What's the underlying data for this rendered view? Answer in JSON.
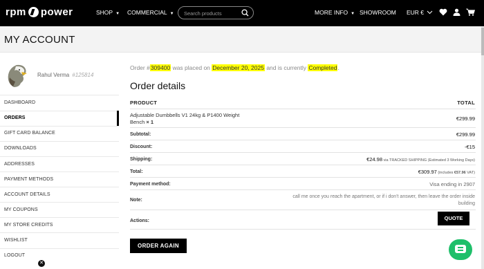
{
  "header": {
    "brand": {
      "left": "rpm",
      "right": "power"
    },
    "nav_left": [
      {
        "label": "SHOP",
        "dropdown": true
      },
      {
        "label": "COMMERCIAL",
        "dropdown": true
      }
    ],
    "search": {
      "placeholder": "Search products",
      "value": ""
    },
    "nav_right": [
      {
        "label": "MORE INFO",
        "dropdown": true
      },
      {
        "label": "SHOWROOM",
        "dropdown": false
      }
    ],
    "currency": "EUR €",
    "icons": [
      "heart-icon",
      "user-icon",
      "cart-icon"
    ]
  },
  "page_title": "MY ACCOUNT",
  "user": {
    "name": "Rahul Verma",
    "id": "#125814"
  },
  "sidebar": {
    "items": [
      {
        "label": "DASHBOARD",
        "active": false
      },
      {
        "label": "ORDERS",
        "active": true
      },
      {
        "label": "GIFT CARD BALANCE",
        "active": false
      },
      {
        "label": "DOWNLOADS",
        "active": false
      },
      {
        "label": "ADDRESSES",
        "active": false
      },
      {
        "label": "PAYMENT METHODS",
        "active": false
      },
      {
        "label": "ACCOUNT DETAILS",
        "active": false
      },
      {
        "label": "MY COUPONS",
        "active": false
      },
      {
        "label": "MY STORE CREDITS",
        "active": false
      },
      {
        "label": "WISHLIST",
        "active": false
      },
      {
        "label": "LOGOUT",
        "active": false
      }
    ]
  },
  "order": {
    "notice": {
      "prefix": "Order #",
      "number": "309400",
      "mid1": " was placed on ",
      "date": "December 20, 2025",
      "mid2": " and is currently ",
      "status": "Completed",
      "suffix": "."
    },
    "title": "Order details",
    "columns": {
      "product": "PRODUCT",
      "total": "TOTAL"
    },
    "item": {
      "name_line1": "Adjustable Dumbbells V1 24kg & P1400 Weight",
      "name_line2": "Bench",
      "qty": "× 1",
      "total": "€299.99"
    },
    "subtotal": {
      "label": "Subtotal:",
      "value": "€299.99"
    },
    "discount": {
      "label": "Discount:",
      "value": "-€15"
    },
    "shipping": {
      "label": "Shipping:",
      "value": "€24.98",
      "note": " via TRACKED SHIPPING (Estimated 3 Working Days)"
    },
    "total": {
      "label": "Total:",
      "value": "€309.97",
      "note_prefix": " (includes ",
      "vat": "€57.96",
      "note_suffix": " VAT)"
    },
    "payment": {
      "label": "Payment method:",
      "value": "Visa ending in 2907"
    },
    "note": {
      "label": "Note:",
      "line1": "call me once you reach the apartment, or if i don't answer, then leave the order inside",
      "line2": "building"
    },
    "actions": {
      "label": "Actions:",
      "quote": "QUOTE"
    },
    "order_again": "ORDER AGAIN"
  },
  "colors": {
    "highlight": "#ffff00",
    "chat": "#1fbf6a",
    "header_bg": "#000000"
  }
}
